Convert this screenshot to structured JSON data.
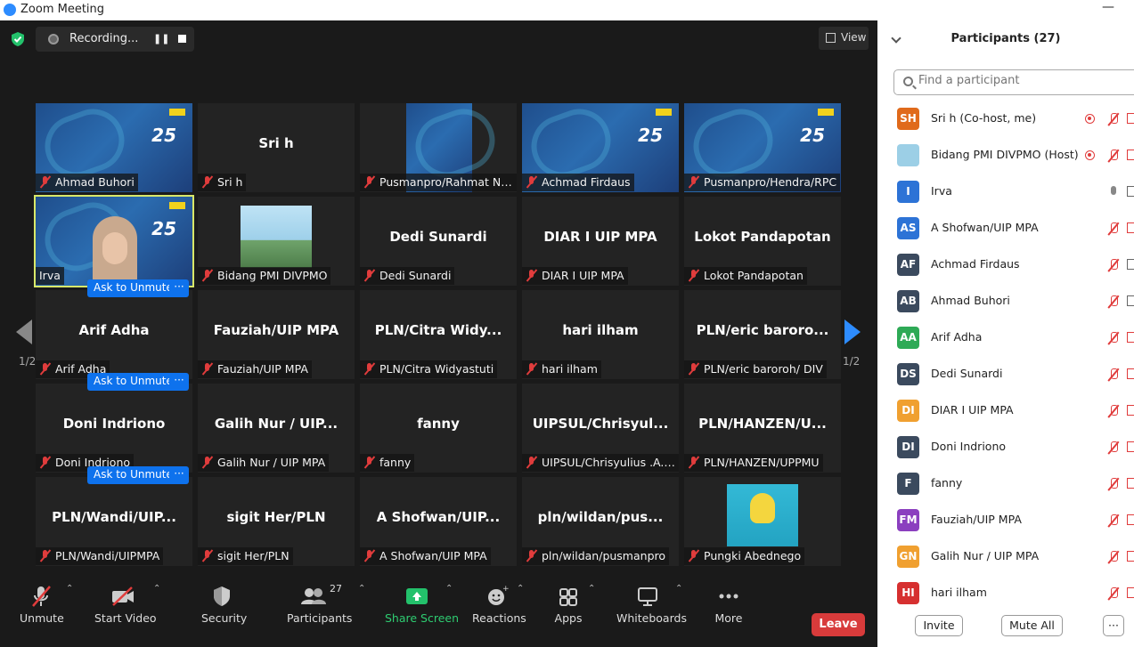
{
  "window": {
    "title": "Zoom Meeting",
    "minimize": "—"
  },
  "top_bar": {
    "recording_label": "Recording...",
    "view_label": "View"
  },
  "tiles": [
    {
      "name": "Ahmad Buhori",
      "center": "",
      "kind": "slide"
    },
    {
      "name": "Sri h",
      "center": "Sri h",
      "kind": "plain"
    },
    {
      "name": "Pusmanpro/Rahmat Nic...",
      "center": "",
      "kind": "slide-partial"
    },
    {
      "name": "Achmad Firdaus",
      "center": "",
      "kind": "slide"
    },
    {
      "name": "Pusmanpro/Hendra/RPC",
      "center": "",
      "kind": "slide"
    },
    {
      "name": "Irva",
      "center": "",
      "kind": "video"
    },
    {
      "name": "Bidang PMI DIVPMO",
      "center": "",
      "kind": "photo"
    },
    {
      "name": "Dedi Sunardi",
      "center": "Dedi Sunardi",
      "kind": "plain"
    },
    {
      "name": "DIAR I UIP MPA",
      "center": "DIAR I UIP MPA",
      "kind": "plain"
    },
    {
      "name": "Lokot Pandapotan",
      "center": "Lokot Pandapotan",
      "kind": "plain"
    },
    {
      "name": "Arif Adha",
      "center": "Arif Adha",
      "kind": "plain"
    },
    {
      "name": "Fauziah/UIP MPA",
      "center": "Fauziah/UIP MPA",
      "kind": "plain"
    },
    {
      "name": "PLN/Citra Widyastuti",
      "center": "PLN/Citra  Widy...",
      "kind": "plain"
    },
    {
      "name": "hari ilham",
      "center": "hari ilham",
      "kind": "plain"
    },
    {
      "name": "PLN/eric baroroh/ DIV",
      "center": "PLN/eric  baroro...",
      "kind": "plain"
    },
    {
      "name": "Doni Indriono",
      "center": "Doni Indriono",
      "kind": "plain"
    },
    {
      "name": "Galih Nur / UIP MPA",
      "center": "Galih Nur / UIP...",
      "kind": "plain"
    },
    {
      "name": "fanny",
      "center": "fanny",
      "kind": "plain"
    },
    {
      "name": "UIPSUL/Chrisyulius .A.B/...",
      "center": "UIPSUL/Chrisyul...",
      "kind": "plain"
    },
    {
      "name": "PLN/HANZEN/UPPMU",
      "center": "PLN/HANZEN/U...",
      "kind": "plain"
    },
    {
      "name": "PLN/Wandi/UIPMPA",
      "center": "PLN/Wandi/UIP...",
      "kind": "plain"
    },
    {
      "name": "sigit Her/PLN",
      "center": "sigit Her/PLN",
      "kind": "plain"
    },
    {
      "name": "A Shofwan/UIP MPA",
      "center": "A  Shofwan/UIP...",
      "kind": "plain"
    },
    {
      "name": "pln/wildan/pusmanpro",
      "center": "pln/wildan/pus...",
      "kind": "plain"
    },
    {
      "name": "Pungki Abednego",
      "center": "",
      "kind": "poster"
    }
  ],
  "ask_unmute_label": "Ask to Unmute",
  "more_label": "···",
  "page_indicator": "1/2",
  "toolbar": {
    "unmute": "Unmute",
    "start_video": "Start Video",
    "security": "Security",
    "participants": "Participants",
    "participants_count": "27",
    "share_screen": "Share Screen",
    "reactions": "Reactions",
    "apps": "Apps",
    "whiteboards": "Whiteboards",
    "more": "More",
    "leave": "Leave"
  },
  "panel": {
    "title": "Participants (27)",
    "search_placeholder": "Find a participant",
    "invite": "Invite",
    "mute_all": "Mute All",
    "more": "···",
    "participants": [
      {
        "initials": "SH",
        "name": "Sri h (Co-host, me)",
        "color": "#e06a1b",
        "rec": true,
        "mic": "muted"
      },
      {
        "initials": "",
        "name": "Bidang PMI DIVPMO (Host)",
        "color": "#9ccfe6",
        "rec": true,
        "mic": "muted"
      },
      {
        "initials": "I",
        "name": "Irva",
        "color": "#2d73d6",
        "rec": false,
        "mic": "live"
      },
      {
        "initials": "AS",
        "name": "A Shofwan/UIP MPA",
        "color": "#2d73d6",
        "rec": false,
        "mic": "muted"
      },
      {
        "initials": "AF",
        "name": "Achmad Firdaus",
        "color": "#3b4a5e",
        "rec": false,
        "mic": "muted"
      },
      {
        "initials": "AB",
        "name": "Ahmad Buhori",
        "color": "#3b4a5e",
        "rec": false,
        "mic": "muted"
      },
      {
        "initials": "AA",
        "name": "Arif Adha",
        "color": "#2eaa56",
        "rec": false,
        "mic": "muted"
      },
      {
        "initials": "DS",
        "name": "Dedi Sunardi",
        "color": "#3b4a5e",
        "rec": false,
        "mic": "muted"
      },
      {
        "initials": "DI",
        "name": "DIAR I UIP MPA",
        "color": "#f0a030",
        "rec": false,
        "mic": "muted"
      },
      {
        "initials": "DI",
        "name": "Doni Indriono",
        "color": "#3b4a5e",
        "rec": false,
        "mic": "muted"
      },
      {
        "initials": "F",
        "name": "fanny",
        "color": "#3b4a5e",
        "rec": false,
        "mic": "muted"
      },
      {
        "initials": "FM",
        "name": "Fauziah/UIP MPA",
        "color": "#8b3fbf",
        "rec": false,
        "mic": "muted"
      },
      {
        "initials": "GN",
        "name": "Galih Nur / UIP MPA",
        "color": "#f0a030",
        "rec": false,
        "mic": "muted"
      },
      {
        "initials": "HI",
        "name": "hari ilham",
        "color": "#d63030",
        "rec": false,
        "mic": "muted"
      }
    ]
  }
}
